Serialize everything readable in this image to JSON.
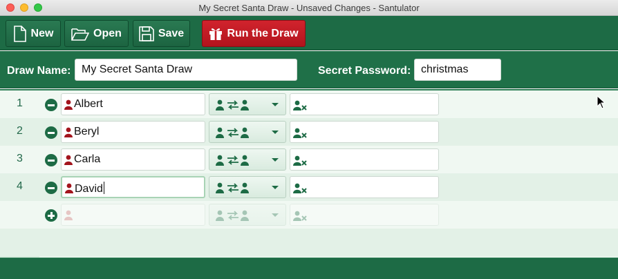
{
  "window": {
    "title": "My Secret Santa Draw - Unsaved Changes - Santulator"
  },
  "toolbar": {
    "new_label": "New",
    "open_label": "Open",
    "save_label": "Save",
    "run_label": "Run the Draw"
  },
  "form": {
    "draw_name_label": "Draw Name:",
    "draw_name_value": "My Secret Santa Draw",
    "password_label": "Secret Password:",
    "password_value": "christmas"
  },
  "participants": [
    {
      "num": "1",
      "name": "Albert"
    },
    {
      "num": "2",
      "name": "Beryl"
    },
    {
      "num": "3",
      "name": "Carla"
    },
    {
      "num": "4",
      "name": "David"
    }
  ],
  "colors": {
    "green": "#1d6b45",
    "red": "#b2141d",
    "person_red": "#a3151e"
  },
  "icons": [
    "new-file-icon",
    "open-folder-icon",
    "save-disk-icon",
    "gift-icon",
    "remove-icon",
    "add-icon",
    "person-icon",
    "swap-icon",
    "chevron-down-icon",
    "person-exclude-icon"
  ]
}
